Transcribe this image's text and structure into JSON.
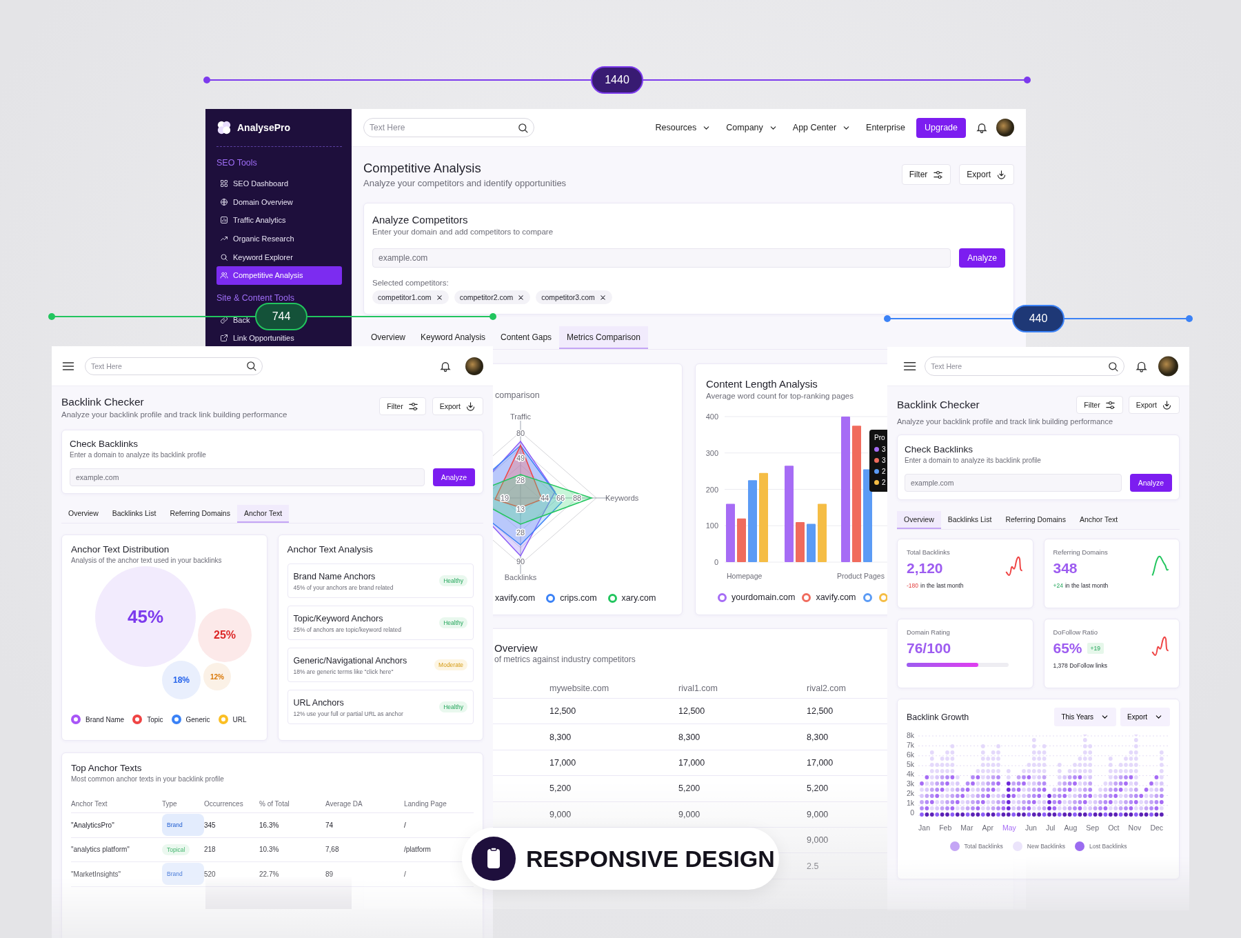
{
  "markers": [
    {
      "label": "1440",
      "color": "#7c3aed"
    },
    {
      "label": "744",
      "color": "#22c55e"
    },
    {
      "label": "440",
      "color": "#3b82f6"
    }
  ],
  "desktop": {
    "brand": "AnalysePro",
    "sidebar": [
      {
        "title": "SEO Tools",
        "items": [
          {
            "label": "SEO Dashboard",
            "kind": "grid",
            "selected": false
          },
          {
            "label": "Domain Overview",
            "kind": "globe",
            "selected": false
          },
          {
            "label": "Traffic Analytics",
            "kind": "chart",
            "selected": false
          },
          {
            "label": "Organic Research",
            "kind": "trend",
            "selected": false
          },
          {
            "label": "Keyword Explorer",
            "kind": "search",
            "selected": false
          },
          {
            "label": "Competitive Analysis",
            "kind": "users",
            "selected": true
          }
        ]
      },
      {
        "title": "Site & Content Tools",
        "items": [
          {
            "label": "Back",
            "kind": "link",
            "selected": false
          },
          {
            "label": "Link Opportunities",
            "kind": "external",
            "selected": false
          }
        ]
      }
    ],
    "search": {
      "placeholder": "Text Here"
    },
    "nav": [
      {
        "label": "Resources",
        "dropdown": true
      },
      {
        "label": "Company",
        "dropdown": true
      },
      {
        "label": "App Center",
        "dropdown": true
      },
      {
        "label": "Enterprise",
        "dropdown": false
      }
    ],
    "upgrade": "Upgrade",
    "title": "Competitive Analysis",
    "subtitle": "Analyze your competitors and identify opportunities",
    "actions": [
      {
        "label": "Filter",
        "kind": "filter"
      },
      {
        "label": "Export",
        "kind": "download"
      }
    ],
    "analyze": {
      "title": "Analyze Competitors",
      "subtitle": "Enter your domain and add competitors to compare",
      "placeholder": "example.com",
      "button": "Analyze",
      "selected_label": "Selected competitors:",
      "competitors": [
        "competitor1.com",
        "competitor2.com",
        "competitor3.com"
      ]
    },
    "tabs": [
      {
        "label": "Overview",
        "selected": false
      },
      {
        "label": "Keyword Analysis",
        "selected": false
      },
      {
        "label": "Content Gaps",
        "selected": false
      },
      {
        "label": "Metrics Comparison",
        "selected": true
      }
    ],
    "radar": {
      "subtitle": "comparison",
      "axes": [
        "Traffic",
        "Keywords",
        "Backlinks"
      ],
      "ticks": [
        "80",
        "49",
        "28",
        "19",
        "44",
        "66",
        "88",
        "13",
        "28",
        "90"
      ],
      "legend": [
        {
          "label": "xavify.com"
        },
        {
          "label": "crips.com",
          "color": "#3b82f6"
        },
        {
          "label": "xary.com",
          "color": "#22c55e"
        }
      ]
    },
    "content_length": {
      "title": "Content Length Analysis",
      "subtitle": "Average word count for top-ranking pages",
      "chart_data": {
        "type": "bar",
        "grid": true,
        "categories": [
          "Homepage",
          null,
          "Product Pages"
        ],
        "ylim": [
          0,
          400
        ],
        "yticks": [
          0,
          100,
          200,
          300,
          400
        ],
        "series": [
          {
            "name": "yourdomain.com",
            "color": "#a66cf5",
            "values": [
              160,
              265,
              400
            ]
          },
          {
            "name": "xavify.com",
            "color": "#f06b5d",
            "values": [
              120,
              110,
              375
            ]
          },
          {
            "color": "#5b9bf5",
            "values": [
              225,
              105,
              255
            ]
          },
          {
            "color": "#f5bd45",
            "values": [
              245,
              160,
              null
            ]
          }
        ]
      },
      "tooltip": {
        "title": "Pro",
        "items": [
          {
            "color": "#a66cf5",
            "text": "3"
          },
          {
            "color": "#f06b5d",
            "text": "3"
          },
          {
            "color": "#5b9bf5",
            "text": "2"
          },
          {
            "color": "#f5bd45",
            "text": "2"
          }
        ]
      }
    },
    "overview": {
      "title": "Overview",
      "subtitle": "of metrics against industry competitors",
      "columns": [
        "mywebsite.com",
        "rival1.com",
        "rival2.com"
      ],
      "rows": [
        [
          "12,500",
          "12,500",
          "12,500"
        ],
        [
          "8,300",
          "8,300",
          "8,300"
        ],
        [
          "17,000",
          "17,000",
          "17,000"
        ],
        [
          "5,200",
          "5,200",
          "5,200"
        ],
        [
          "9,000",
          "9,000",
          "9,000"
        ],
        [
          null,
          null,
          "9,000"
        ],
        [
          null,
          null,
          "2.5"
        ]
      ]
    }
  },
  "tablet": {
    "search": {
      "placeholder": "Text Here"
    },
    "title": "Backlink Checker",
    "subtitle": "Analyze your backlink profile and track link building performance",
    "actions": [
      {
        "label": "Filter",
        "kind": "filter"
      },
      {
        "label": "Export",
        "kind": "download"
      }
    ],
    "check": {
      "title": "Check Backlinks",
      "subtitle": "Enter a domain to analyze its backlink profile",
      "placeholder": "example.com",
      "button": "Analyze"
    },
    "tabs": [
      {
        "label": "Overview",
        "selected": false
      },
      {
        "label": "Backlinks List",
        "selected": false
      },
      {
        "label": "Referring Domains",
        "selected": false
      },
      {
        "label": "Anchor Text",
        "selected": true
      }
    ],
    "distribution": {
      "title": "Anchor Text Distribution",
      "subtitle": "Analysis of the anchor text used in your backlinks",
      "bubbles": [
        {
          "label": "45%",
          "color": "#7c3aed"
        },
        {
          "label": "25%",
          "color": "#dc2626"
        },
        {
          "label": "18%",
          "color": "#2563eb"
        },
        {
          "label": "12%",
          "color": "#d97706"
        }
      ],
      "legend": [
        {
          "label": "Brand Name",
          "color": "#a855f7"
        },
        {
          "label": "Topic",
          "color": "#ef4444"
        },
        {
          "label": "Generic",
          "color": "#3b82f6"
        },
        {
          "label": "URL",
          "color": "#fbbf24"
        }
      ]
    },
    "analysis": {
      "title": "Anchor Text Analysis",
      "items": [
        {
          "title": "Brand Name Anchors",
          "text": "45% of your anchors are brand related",
          "status": "Healthy",
          "kind": "good"
        },
        {
          "title": "Topic/Keyword Anchors",
          "text": "25% of anchors are topic/keyword related",
          "status": "Healthy",
          "kind": "good"
        },
        {
          "title": "Generic/Navigational Anchors",
          "text": "18% are generic terms like \"click here\"",
          "status": "Moderate",
          "kind": "warn"
        },
        {
          "title": "URL Anchors",
          "text": "12% use your full or partial URL as anchor",
          "status": "Healthy",
          "kind": "good"
        }
      ]
    },
    "top": {
      "title": "Top Anchor Texts",
      "subtitle": "Most common anchor texts in your backlink profile",
      "columns": [
        "Anchor Text",
        "Type",
        "Occurrences",
        "% of Total",
        "Average DA",
        "Landing Page"
      ],
      "rows": [
        {
          "cells": [
            "\"AnalyticsPro\"",
            "Brand",
            "345",
            "16.3%",
            "74",
            "/"
          ],
          "kind": "brand"
        },
        {
          "cells": [
            "\"analytics platform\"",
            "Topical",
            "218",
            "10.3%",
            "7,68",
            "/platform"
          ],
          "kind": "topical"
        },
        {
          "cells": [
            "\"MarketInsights\"",
            "Brand",
            "520",
            "22.7%",
            "89",
            "/"
          ],
          "kind": "brand"
        }
      ]
    }
  },
  "mobile": {
    "search": {
      "placeholder": "Text Here"
    },
    "title": "Backlink Checker",
    "subtitle": "Analyze your backlink profile and track link building performance",
    "actions": [
      {
        "label": "Filter",
        "kind": "filter"
      },
      {
        "label": "Export",
        "kind": "download"
      }
    ],
    "check": {
      "title": "Check Backlinks",
      "subtitle": "Enter a domain to analyze its backlink profile",
      "placeholder": "example.com",
      "button": "Analyze"
    },
    "tabs": [
      {
        "label": "Overview",
        "selected": true
      },
      {
        "label": "Backlinks List",
        "selected": false
      },
      {
        "label": "Referring Domains",
        "selected": false
      },
      {
        "label": "Anchor Text",
        "selected": false
      }
    ],
    "stats": [
      {
        "kind": "trend",
        "label": "Total Backlinks",
        "value": "2,120",
        "delta": "-180",
        "positive": false,
        "note": "in the last month",
        "color": "#ef4444"
      },
      {
        "kind": "trend",
        "label": "Referring Domains",
        "value": "348",
        "delta": "+24",
        "positive": true,
        "note": "in the last month",
        "color": "#22c55e"
      },
      {
        "kind": "progress",
        "label": "Domain Rating",
        "value": "76/100",
        "level": 0.7
      },
      {
        "kind": "badge",
        "label": "DoFollow Ratio",
        "value": "65%",
        "badge": "+19",
        "note": "1,378 DoFollow links",
        "color": "#ef4444"
      }
    ],
    "growth": {
      "title": "Backlink Growth",
      "controls": [
        "This Years",
        "Export"
      ],
      "yticks": [
        "8k",
        "7k",
        "6k",
        "5k",
        "4k",
        "3k",
        "2k",
        "1k",
        "0"
      ],
      "months": [
        {
          "label": "Jan",
          "selected": false
        },
        {
          "label": "Feb",
          "selected": false
        },
        {
          "label": "Mar",
          "selected": false
        },
        {
          "label": "Apr",
          "selected": false
        },
        {
          "label": "May",
          "selected": true
        },
        {
          "label": "Jun",
          "selected": false
        },
        {
          "label": "Jul",
          "selected": false
        },
        {
          "label": "Aug",
          "selected": false
        },
        {
          "label": "Sep",
          "selected": false
        },
        {
          "label": "Oct",
          "selected": false
        },
        {
          "label": "Nov",
          "selected": false
        },
        {
          "label": "Dec",
          "selected": false
        }
      ],
      "legend": [
        {
          "label": "Total Backlinks",
          "color": "#c4a5f5"
        },
        {
          "label": "New Backlinks",
          "color": "#ebe4fb"
        },
        {
          "label": "Lost Backlinks",
          "color": "#9b6cf0"
        }
      ]
    }
  },
  "banner": {
    "label": "RESPONSIVE DESIGN"
  }
}
